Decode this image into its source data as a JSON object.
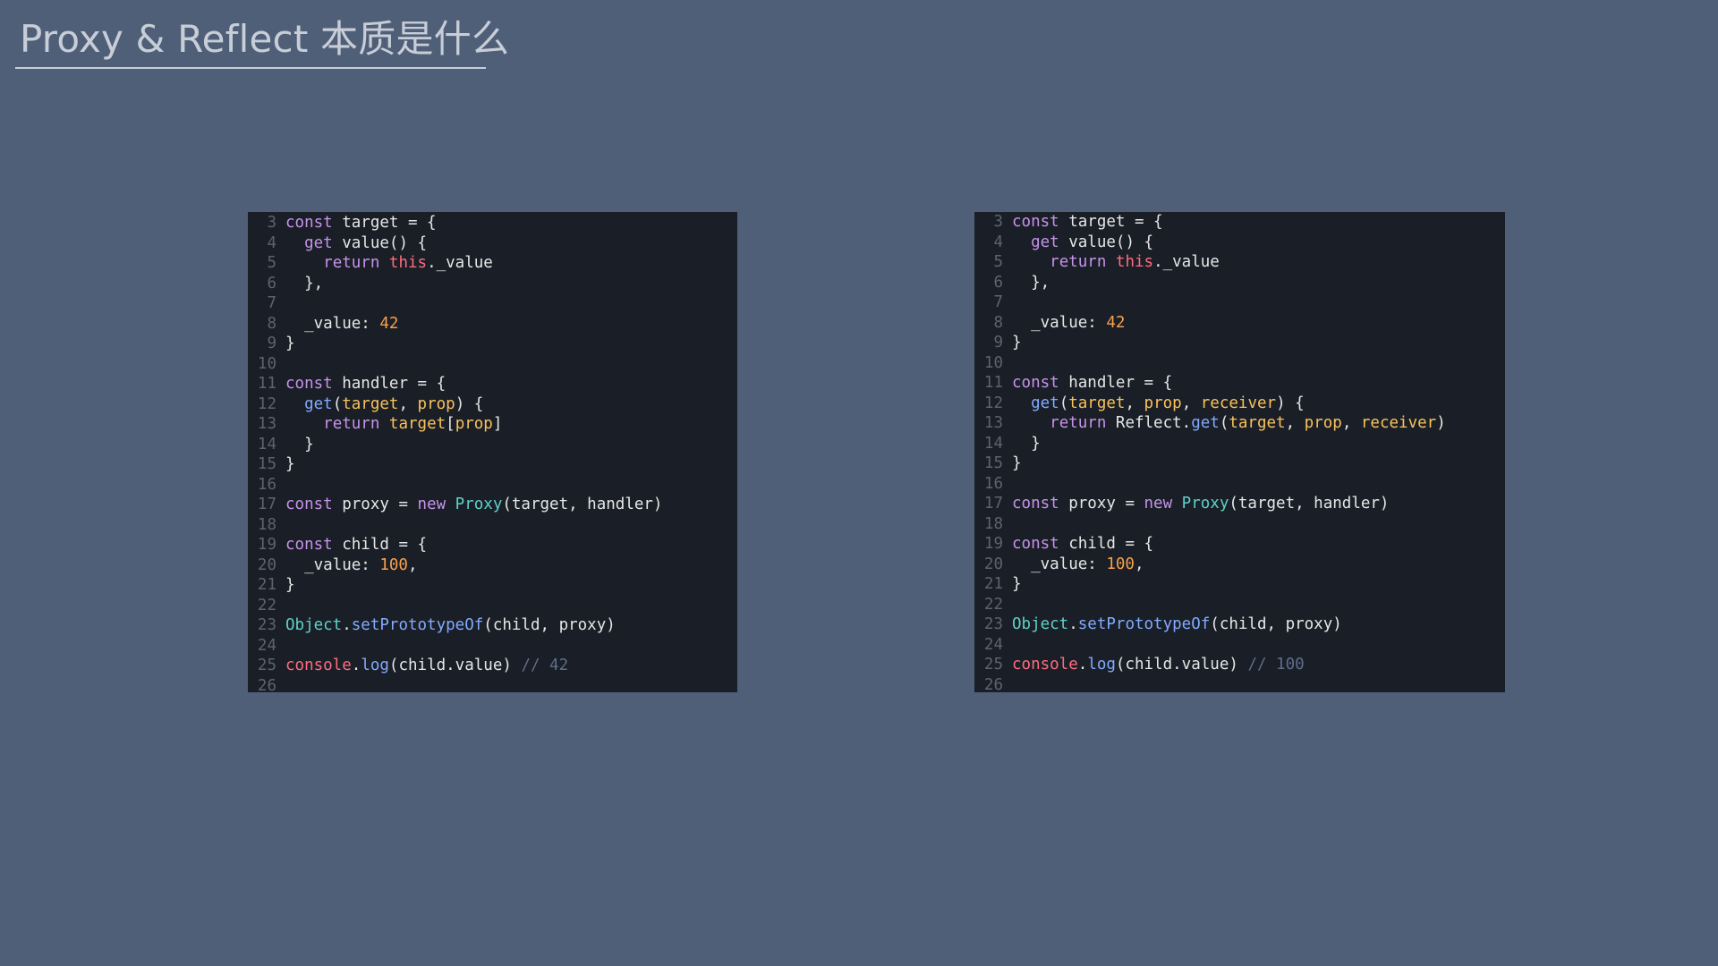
{
  "slide": {
    "title": "Proxy & Reflect 本质是什么"
  },
  "colors": {
    "background": "#505f78",
    "panel": "#1a1f27",
    "keyword": "#c792ea",
    "function": "#82aaff",
    "parameter": "#f9c25b",
    "number": "#f7a04c",
    "this": "#ff6c7e",
    "class": "#5fd1c9",
    "comment": "#5e6d8a",
    "line_number": "#5c6370"
  },
  "left_code": {
    "lines": [
      {
        "n": "3",
        "tokens": [
          [
            "kw",
            "const"
          ],
          [
            "pl",
            " target = {"
          ]
        ]
      },
      {
        "n": "4",
        "tokens": [
          [
            "pl",
            "  "
          ],
          [
            "kw",
            "get"
          ],
          [
            "pl",
            " value() {"
          ]
        ]
      },
      {
        "n": "5",
        "tokens": [
          [
            "pl",
            "    "
          ],
          [
            "kw",
            "return"
          ],
          [
            "pl",
            " "
          ],
          [
            "this",
            "this"
          ],
          [
            "pl",
            "._value"
          ]
        ]
      },
      {
        "n": "6",
        "tokens": [
          [
            "pl",
            "  },"
          ]
        ]
      },
      {
        "n": "7",
        "tokens": []
      },
      {
        "n": "8",
        "tokens": [
          [
            "pl",
            "  _value: "
          ],
          [
            "num",
            "42"
          ]
        ]
      },
      {
        "n": "9",
        "tokens": [
          [
            "pl",
            "}"
          ]
        ]
      },
      {
        "n": "10",
        "tokens": []
      },
      {
        "n": "11",
        "tokens": [
          [
            "kw",
            "const"
          ],
          [
            "pl",
            " handler = {"
          ]
        ]
      },
      {
        "n": "12",
        "tokens": [
          [
            "pl",
            "  "
          ],
          [
            "fn",
            "get"
          ],
          [
            "pl",
            "("
          ],
          [
            "prop",
            "target"
          ],
          [
            "pl",
            ", "
          ],
          [
            "prop",
            "prop"
          ],
          [
            "pl",
            ") {"
          ]
        ]
      },
      {
        "n": "13",
        "tokens": [
          [
            "pl",
            "    "
          ],
          [
            "kw",
            "return"
          ],
          [
            "pl",
            " "
          ],
          [
            "prop",
            "target"
          ],
          [
            "pl",
            "["
          ],
          [
            "prop",
            "prop"
          ],
          [
            "pl",
            "]"
          ]
        ]
      },
      {
        "n": "14",
        "tokens": [
          [
            "pl",
            "  }"
          ]
        ]
      },
      {
        "n": "15",
        "tokens": [
          [
            "pl",
            "}"
          ]
        ]
      },
      {
        "n": "16",
        "tokens": []
      },
      {
        "n": "17",
        "tokens": [
          [
            "kw",
            "const"
          ],
          [
            "pl",
            " proxy = "
          ],
          [
            "kw",
            "new"
          ],
          [
            "pl",
            " "
          ],
          [
            "cls",
            "Proxy"
          ],
          [
            "pl",
            "(target, handler)"
          ]
        ]
      },
      {
        "n": "18",
        "tokens": []
      },
      {
        "n": "19",
        "tokens": [
          [
            "kw",
            "const"
          ],
          [
            "pl",
            " child = {"
          ]
        ]
      },
      {
        "n": "20",
        "tokens": [
          [
            "pl",
            "  _value: "
          ],
          [
            "num",
            "100"
          ],
          [
            "pl",
            ","
          ]
        ]
      },
      {
        "n": "21",
        "tokens": [
          [
            "pl",
            "}"
          ]
        ]
      },
      {
        "n": "22",
        "tokens": []
      },
      {
        "n": "23",
        "tokens": [
          [
            "cls",
            "Object"
          ],
          [
            "pl",
            "."
          ],
          [
            "fn",
            "setPrototypeOf"
          ],
          [
            "pl",
            "(child, proxy)"
          ]
        ]
      },
      {
        "n": "24",
        "tokens": []
      },
      {
        "n": "25",
        "tokens": [
          [
            "this",
            "console"
          ],
          [
            "pl",
            "."
          ],
          [
            "fn",
            "log"
          ],
          [
            "pl",
            "(child.value) "
          ],
          [
            "cm",
            "// 42"
          ]
        ]
      },
      {
        "n": "26",
        "tokens": []
      }
    ]
  },
  "right_code": {
    "lines": [
      {
        "n": "3",
        "tokens": [
          [
            "kw",
            "const"
          ],
          [
            "pl",
            " target = {"
          ]
        ]
      },
      {
        "n": "4",
        "tokens": [
          [
            "pl",
            "  "
          ],
          [
            "kw",
            "get"
          ],
          [
            "pl",
            " value() {"
          ]
        ]
      },
      {
        "n": "5",
        "tokens": [
          [
            "pl",
            "    "
          ],
          [
            "kw",
            "return"
          ],
          [
            "pl",
            " "
          ],
          [
            "this",
            "this"
          ],
          [
            "pl",
            "._value"
          ]
        ]
      },
      {
        "n": "6",
        "tokens": [
          [
            "pl",
            "  },"
          ]
        ]
      },
      {
        "n": "7",
        "tokens": []
      },
      {
        "n": "8",
        "tokens": [
          [
            "pl",
            "  _value: "
          ],
          [
            "num",
            "42"
          ]
        ]
      },
      {
        "n": "9",
        "tokens": [
          [
            "pl",
            "}"
          ]
        ]
      },
      {
        "n": "10",
        "tokens": []
      },
      {
        "n": "11",
        "tokens": [
          [
            "kw",
            "const"
          ],
          [
            "pl",
            " handler = {"
          ]
        ]
      },
      {
        "n": "12",
        "tokens": [
          [
            "pl",
            "  "
          ],
          [
            "fn",
            "get"
          ],
          [
            "pl",
            "("
          ],
          [
            "prop",
            "target"
          ],
          [
            "pl",
            ", "
          ],
          [
            "prop",
            "prop"
          ],
          [
            "pl",
            ", "
          ],
          [
            "prop",
            "receiver"
          ],
          [
            "pl",
            ") {"
          ]
        ]
      },
      {
        "n": "13",
        "tokens": [
          [
            "pl",
            "    "
          ],
          [
            "kw",
            "return"
          ],
          [
            "pl",
            " Reflect."
          ],
          [
            "fn",
            "get"
          ],
          [
            "pl",
            "("
          ],
          [
            "prop",
            "target"
          ],
          [
            "pl",
            ", "
          ],
          [
            "prop",
            "prop"
          ],
          [
            "pl",
            ", "
          ],
          [
            "prop",
            "receiver"
          ],
          [
            "pl",
            ")"
          ]
        ]
      },
      {
        "n": "14",
        "tokens": [
          [
            "pl",
            "  }"
          ]
        ]
      },
      {
        "n": "15",
        "tokens": [
          [
            "pl",
            "}"
          ]
        ]
      },
      {
        "n": "16",
        "tokens": []
      },
      {
        "n": "17",
        "tokens": [
          [
            "kw",
            "const"
          ],
          [
            "pl",
            " proxy = "
          ],
          [
            "kw",
            "new"
          ],
          [
            "pl",
            " "
          ],
          [
            "cls",
            "Proxy"
          ],
          [
            "pl",
            "(target, handler)"
          ]
        ]
      },
      {
        "n": "18",
        "tokens": []
      },
      {
        "n": "19",
        "tokens": [
          [
            "kw",
            "const"
          ],
          [
            "pl",
            " child = {"
          ]
        ]
      },
      {
        "n": "20",
        "tokens": [
          [
            "pl",
            "  _value: "
          ],
          [
            "num",
            "100"
          ],
          [
            "pl",
            ","
          ]
        ]
      },
      {
        "n": "21",
        "tokens": [
          [
            "pl",
            "}"
          ]
        ]
      },
      {
        "n": "22",
        "tokens": []
      },
      {
        "n": "23",
        "tokens": [
          [
            "cls",
            "Object"
          ],
          [
            "pl",
            "."
          ],
          [
            "fn",
            "setPrototypeOf"
          ],
          [
            "pl",
            "(child, proxy)"
          ]
        ]
      },
      {
        "n": "24",
        "tokens": []
      },
      {
        "n": "25",
        "tokens": [
          [
            "this",
            "console"
          ],
          [
            "pl",
            "."
          ],
          [
            "fn",
            "log"
          ],
          [
            "pl",
            "(child.value) "
          ],
          [
            "cm",
            "// 100"
          ]
        ]
      },
      {
        "n": "26",
        "tokens": []
      }
    ]
  }
}
